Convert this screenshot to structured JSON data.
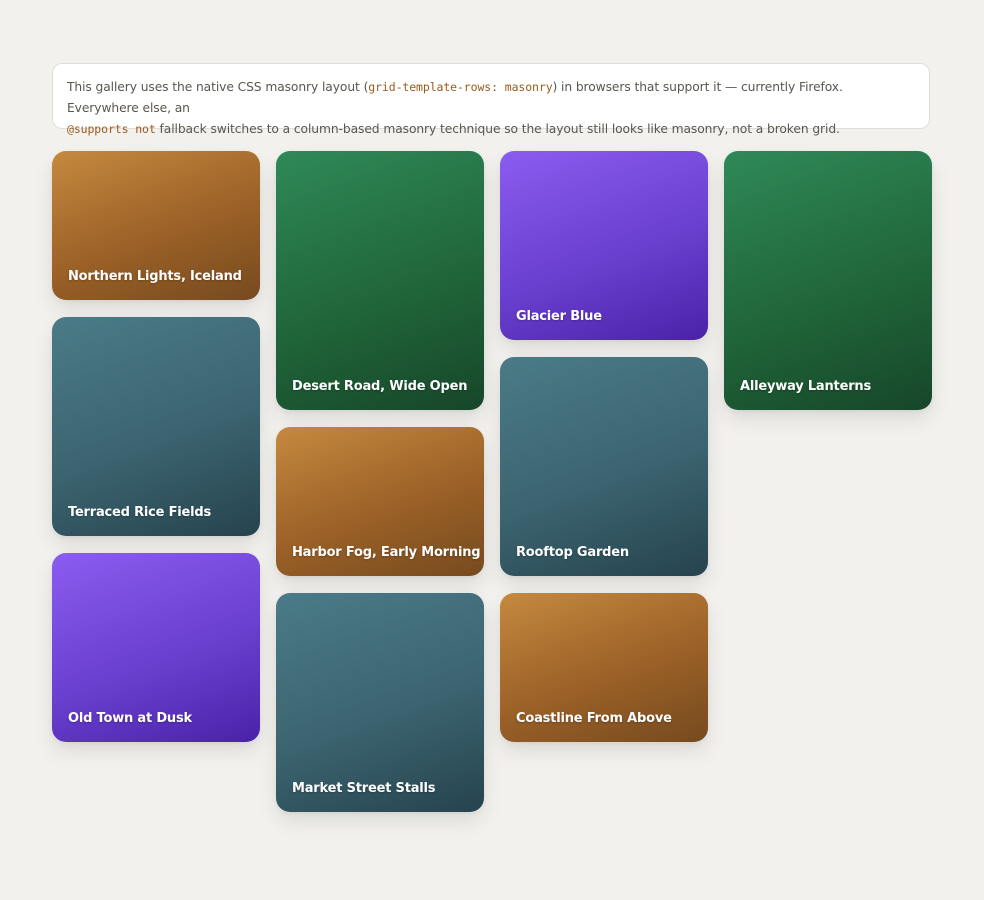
{
  "notice": {
    "part1": "This gallery uses the native CSS masonry layout (",
    "code1": "grid-template-rows: masonry",
    "part2": ") in browsers that support it — currently Firefox. Everywhere else, an",
    "code2": "@supports not",
    "part3": " fallback switches to a column-based masonry technique so the layout still looks like masonry, not a broken grid."
  },
  "gallery": {
    "items": [
      {
        "title": "Northern Lights, Iceland",
        "color": "amber"
      },
      {
        "title": "Desert Road, Wide Open",
        "color": "green"
      },
      {
        "title": "Glacier Blue",
        "color": "violet"
      },
      {
        "title": "Alleyway Lanterns",
        "color": "green"
      },
      {
        "title": "Terraced Rice Fields",
        "color": "slate"
      },
      {
        "title": "Harbor Fog, Early Morning",
        "color": "amber"
      },
      {
        "title": "Rooftop Garden",
        "color": "slate"
      },
      {
        "title": "Old Town at Dusk",
        "color": "violet"
      },
      {
        "title": "Market Street Stalls",
        "color": "slate"
      },
      {
        "title": "Coastline From Above",
        "color": "amber"
      }
    ]
  },
  "colors": {
    "amber": "#b27535",
    "green": "#24734a",
    "violet": "#6c42d6",
    "slate": "#3e6975",
    "background": "#f2f1ed"
  }
}
